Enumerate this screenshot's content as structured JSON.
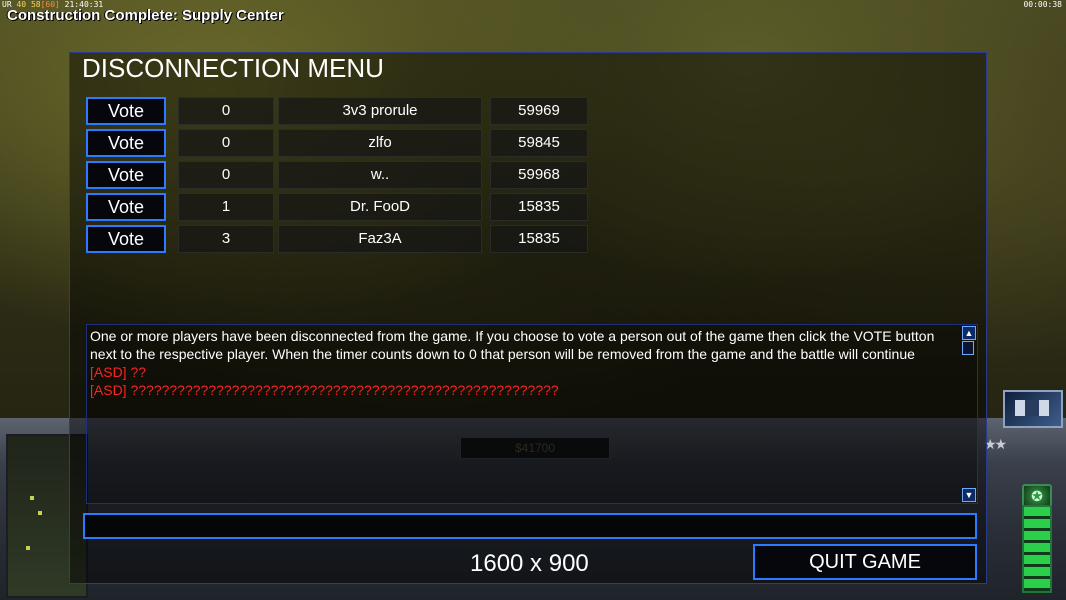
{
  "hud": {
    "status_prefix": "UR",
    "stat_a": "40",
    "stat_b": "58",
    "stat_c": "[60]",
    "clock": "21:40:31",
    "game_timer": "00:00:38",
    "message": "Construction Complete: Supply Center",
    "money": "$41700"
  },
  "menu": {
    "title": "DISCONNECTION MENU",
    "players": [
      {
        "vote_label": "Vote",
        "votes": "0",
        "name": "3v3 prorule",
        "ping": "59969"
      },
      {
        "vote_label": "Vote",
        "votes": "0",
        "name": "zlfo",
        "ping": "59845"
      },
      {
        "vote_label": "Vote",
        "votes": "0",
        "name": "w..",
        "ping": "59968"
      },
      {
        "vote_label": "Vote",
        "votes": "1",
        "name": "Dr. FooD",
        "ping": "15835"
      },
      {
        "vote_label": "Vote",
        "votes": "3",
        "name": "Faz3A",
        "ping": "15835"
      }
    ],
    "chat": {
      "system_message": "One or more players have been disconnected from the game. If you choose to vote a person out of the game then click the VOTE button next to the respective player. When the timer counts down to 0 that person will be removed from the game and the battle will continue",
      "lines": [
        "[ASD] ??",
        "[ASD] ???????????????????????????????????????????????????????"
      ],
      "scroll_up": "▲",
      "scroll_down": "▼"
    },
    "chat_input_value": "",
    "resolution": "1600 x 900",
    "quit_label": "QUIT GAME"
  },
  "colors": {
    "accent_border": "#2a7bff",
    "chat_red": "#ff2020",
    "power_green": "#2bd04a"
  },
  "icons": {
    "rank": "star-icon",
    "generals": "generals-star-icon",
    "portrait": "satellite-portrait-icon"
  }
}
